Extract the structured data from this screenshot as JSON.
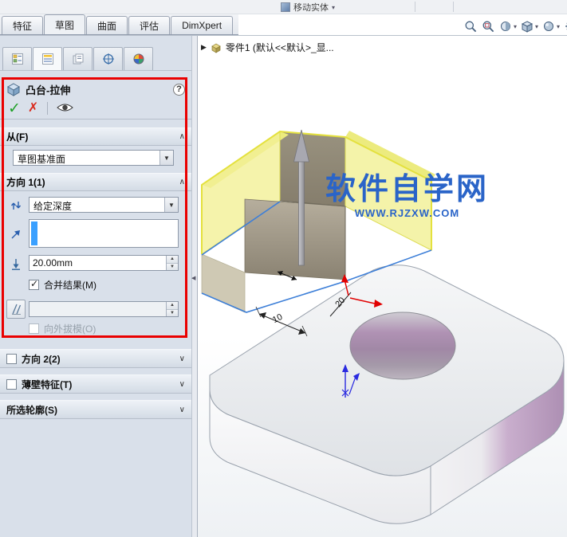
{
  "icons": {
    "caret_down": "▾",
    "chevron_up": "∧",
    "chevron_down": "∨",
    "expand_arrow": "▶",
    "collapse_arrow": "◀",
    "spin_up": "▲",
    "spin_down": "▼",
    "check": "✓",
    "ok": "✓",
    "cancel": "✗",
    "help": "?"
  },
  "commandbar": {
    "partial_tool_label": "移动实体",
    "tabs": [
      {
        "label": "特征",
        "active": false
      },
      {
        "label": "草图",
        "active": true
      },
      {
        "label": "曲面",
        "active": false
      },
      {
        "label": "评估",
        "active": false
      },
      {
        "label": "DimXpert",
        "active": false
      }
    ]
  },
  "tree": {
    "part_label": "零件1 (默认<<默认>_显..."
  },
  "property_manager": {
    "title": "凸台-拉伸",
    "from": {
      "header": "从(F)",
      "value": "草图基准面"
    },
    "direction1": {
      "header": "方向 1(1)",
      "end_condition": "给定深度",
      "depth_value": "20.00mm",
      "merge_label": "合并结果(M)",
      "merge_checked": true,
      "draft_value": "",
      "draft_outward_label": "向外拔模(O)",
      "draft_outward_checked": false
    },
    "direction2": {
      "header": "方向 2(2)",
      "checked": false
    },
    "thin_feature": {
      "header": "薄壁特征(T)",
      "checked": false
    },
    "selected_contours": {
      "header": "所选轮廓(S)"
    }
  },
  "viewport": {
    "watermark_title": "软件自学网",
    "watermark_url": "WWW.RJZXW.COM",
    "dim_10": "10",
    "dim_20": "20"
  }
}
